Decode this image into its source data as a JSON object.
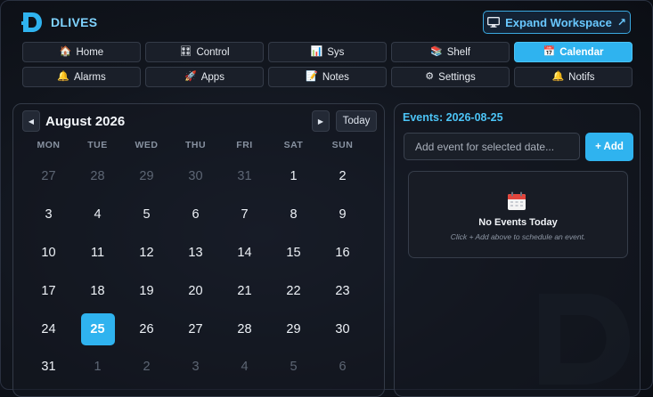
{
  "header": {
    "brand": "DLIVES",
    "expand_label": "Expand Workspace",
    "expand_icon": "monitor-icon"
  },
  "nav": [
    {
      "label": "Home",
      "icon": "🏠",
      "active": false
    },
    {
      "label": "Control",
      "icon": "🎛",
      "active": false
    },
    {
      "label": "Sys",
      "icon": "📊",
      "active": false
    },
    {
      "label": "Shelf",
      "icon": "📚",
      "active": false
    },
    {
      "label": "Calendar",
      "icon": "📅",
      "active": true
    },
    {
      "label": "Alarms",
      "icon": "🔔",
      "active": false
    },
    {
      "label": "Apps",
      "icon": "🚀",
      "active": false
    },
    {
      "label": "Notes",
      "icon": "📝",
      "active": false
    },
    {
      "label": "Settings",
      "icon": "⚙",
      "active": false
    },
    {
      "label": "Notifs",
      "icon": "🔔",
      "active": false
    }
  ],
  "calendar": {
    "month_label": "August 2026",
    "prev_label": "◀",
    "next_label": "▶",
    "today_label": "Today",
    "weekdays": [
      "MON",
      "TUE",
      "WED",
      "THU",
      "FRI",
      "SAT",
      "SUN"
    ],
    "days": [
      {
        "d": "27",
        "muted": true
      },
      {
        "d": "28",
        "muted": true
      },
      {
        "d": "29",
        "muted": true
      },
      {
        "d": "30",
        "muted": true
      },
      {
        "d": "31",
        "muted": true
      },
      {
        "d": "1"
      },
      {
        "d": "2"
      },
      {
        "d": "3"
      },
      {
        "d": "4"
      },
      {
        "d": "5"
      },
      {
        "d": "6"
      },
      {
        "d": "7"
      },
      {
        "d": "8"
      },
      {
        "d": "9"
      },
      {
        "d": "10"
      },
      {
        "d": "11"
      },
      {
        "d": "12"
      },
      {
        "d": "13"
      },
      {
        "d": "14"
      },
      {
        "d": "15"
      },
      {
        "d": "16"
      },
      {
        "d": "17"
      },
      {
        "d": "18"
      },
      {
        "d": "19"
      },
      {
        "d": "20"
      },
      {
        "d": "21"
      },
      {
        "d": "22"
      },
      {
        "d": "23"
      },
      {
        "d": "24"
      },
      {
        "d": "25",
        "selected": true
      },
      {
        "d": "26"
      },
      {
        "d": "27"
      },
      {
        "d": "28"
      },
      {
        "d": "29"
      },
      {
        "d": "30"
      },
      {
        "d": "31"
      },
      {
        "d": "1",
        "muted": true
      },
      {
        "d": "2",
        "muted": true
      },
      {
        "d": "3",
        "muted": true
      },
      {
        "d": "4",
        "muted": true
      },
      {
        "d": "5",
        "muted": true
      },
      {
        "d": "6",
        "muted": true
      }
    ]
  },
  "events": {
    "title": "Events: 2026-08-25",
    "input_placeholder": "Add event for selected date...",
    "input_value": "",
    "add_label": "+ Add",
    "empty_title": "No Events Today",
    "empty_hint": "Click + Add above to schedule an event.",
    "empty_icon": "calendar-icon"
  },
  "colors": {
    "accent": "#2fb3ef",
    "brand": "#7fd3ff",
    "background": "#11151d"
  }
}
